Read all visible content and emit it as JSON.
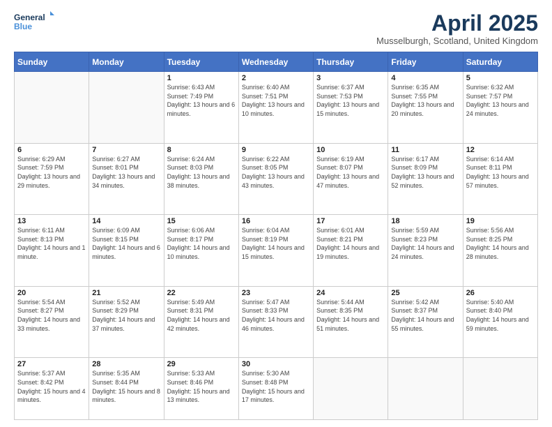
{
  "logo": {
    "line1": "General",
    "line2": "Blue"
  },
  "title": "April 2025",
  "subtitle": "Musselburgh, Scotland, United Kingdom",
  "weekdays": [
    "Sunday",
    "Monday",
    "Tuesday",
    "Wednesday",
    "Thursday",
    "Friday",
    "Saturday"
  ],
  "weeks": [
    [
      {
        "day": "",
        "info": ""
      },
      {
        "day": "",
        "info": ""
      },
      {
        "day": "1",
        "info": "Sunrise: 6:43 AM\nSunset: 7:49 PM\nDaylight: 13 hours and 6 minutes."
      },
      {
        "day": "2",
        "info": "Sunrise: 6:40 AM\nSunset: 7:51 PM\nDaylight: 13 hours and 10 minutes."
      },
      {
        "day": "3",
        "info": "Sunrise: 6:37 AM\nSunset: 7:53 PM\nDaylight: 13 hours and 15 minutes."
      },
      {
        "day": "4",
        "info": "Sunrise: 6:35 AM\nSunset: 7:55 PM\nDaylight: 13 hours and 20 minutes."
      },
      {
        "day": "5",
        "info": "Sunrise: 6:32 AM\nSunset: 7:57 PM\nDaylight: 13 hours and 24 minutes."
      }
    ],
    [
      {
        "day": "6",
        "info": "Sunrise: 6:29 AM\nSunset: 7:59 PM\nDaylight: 13 hours and 29 minutes."
      },
      {
        "day": "7",
        "info": "Sunrise: 6:27 AM\nSunset: 8:01 PM\nDaylight: 13 hours and 34 minutes."
      },
      {
        "day": "8",
        "info": "Sunrise: 6:24 AM\nSunset: 8:03 PM\nDaylight: 13 hours and 38 minutes."
      },
      {
        "day": "9",
        "info": "Sunrise: 6:22 AM\nSunset: 8:05 PM\nDaylight: 13 hours and 43 minutes."
      },
      {
        "day": "10",
        "info": "Sunrise: 6:19 AM\nSunset: 8:07 PM\nDaylight: 13 hours and 47 minutes."
      },
      {
        "day": "11",
        "info": "Sunrise: 6:17 AM\nSunset: 8:09 PM\nDaylight: 13 hours and 52 minutes."
      },
      {
        "day": "12",
        "info": "Sunrise: 6:14 AM\nSunset: 8:11 PM\nDaylight: 13 hours and 57 minutes."
      }
    ],
    [
      {
        "day": "13",
        "info": "Sunrise: 6:11 AM\nSunset: 8:13 PM\nDaylight: 14 hours and 1 minute."
      },
      {
        "day": "14",
        "info": "Sunrise: 6:09 AM\nSunset: 8:15 PM\nDaylight: 14 hours and 6 minutes."
      },
      {
        "day": "15",
        "info": "Sunrise: 6:06 AM\nSunset: 8:17 PM\nDaylight: 14 hours and 10 minutes."
      },
      {
        "day": "16",
        "info": "Sunrise: 6:04 AM\nSunset: 8:19 PM\nDaylight: 14 hours and 15 minutes."
      },
      {
        "day": "17",
        "info": "Sunrise: 6:01 AM\nSunset: 8:21 PM\nDaylight: 14 hours and 19 minutes."
      },
      {
        "day": "18",
        "info": "Sunrise: 5:59 AM\nSunset: 8:23 PM\nDaylight: 14 hours and 24 minutes."
      },
      {
        "day": "19",
        "info": "Sunrise: 5:56 AM\nSunset: 8:25 PM\nDaylight: 14 hours and 28 minutes."
      }
    ],
    [
      {
        "day": "20",
        "info": "Sunrise: 5:54 AM\nSunset: 8:27 PM\nDaylight: 14 hours and 33 minutes."
      },
      {
        "day": "21",
        "info": "Sunrise: 5:52 AM\nSunset: 8:29 PM\nDaylight: 14 hours and 37 minutes."
      },
      {
        "day": "22",
        "info": "Sunrise: 5:49 AM\nSunset: 8:31 PM\nDaylight: 14 hours and 42 minutes."
      },
      {
        "day": "23",
        "info": "Sunrise: 5:47 AM\nSunset: 8:33 PM\nDaylight: 14 hours and 46 minutes."
      },
      {
        "day": "24",
        "info": "Sunrise: 5:44 AM\nSunset: 8:35 PM\nDaylight: 14 hours and 51 minutes."
      },
      {
        "day": "25",
        "info": "Sunrise: 5:42 AM\nSunset: 8:37 PM\nDaylight: 14 hours and 55 minutes."
      },
      {
        "day": "26",
        "info": "Sunrise: 5:40 AM\nSunset: 8:40 PM\nDaylight: 14 hours and 59 minutes."
      }
    ],
    [
      {
        "day": "27",
        "info": "Sunrise: 5:37 AM\nSunset: 8:42 PM\nDaylight: 15 hours and 4 minutes."
      },
      {
        "day": "28",
        "info": "Sunrise: 5:35 AM\nSunset: 8:44 PM\nDaylight: 15 hours and 8 minutes."
      },
      {
        "day": "29",
        "info": "Sunrise: 5:33 AM\nSunset: 8:46 PM\nDaylight: 15 hours and 13 minutes."
      },
      {
        "day": "30",
        "info": "Sunrise: 5:30 AM\nSunset: 8:48 PM\nDaylight: 15 hours and 17 minutes."
      },
      {
        "day": "",
        "info": ""
      },
      {
        "day": "",
        "info": ""
      },
      {
        "day": "",
        "info": ""
      }
    ]
  ]
}
